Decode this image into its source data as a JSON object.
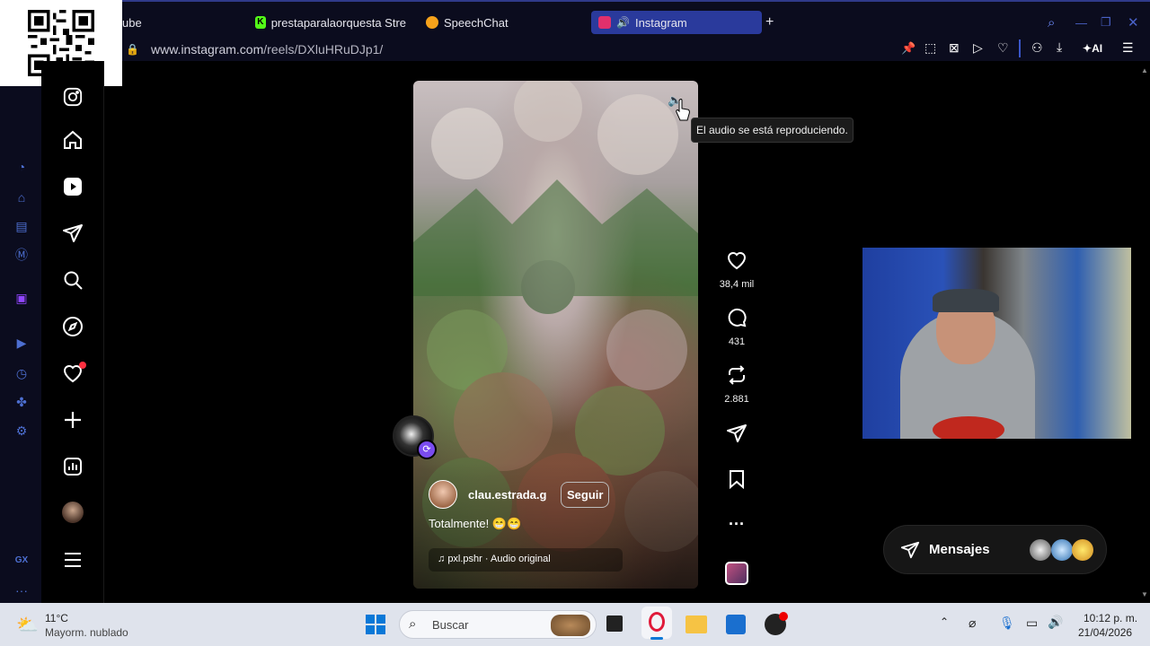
{
  "browser": {
    "tabs": [
      {
        "label": "ube",
        "color": "#ff0000"
      },
      {
        "label": "prestaparalaorquesta Stre",
        "color": "#53fc18"
      },
      {
        "label": "SpeechChat",
        "color": "#f7a21b"
      },
      {
        "label": "Instagram",
        "color": "#e1306c",
        "active": true
      }
    ],
    "new_tab": "+",
    "url_host": "www.instagram.com",
    "url_path": "/reels/DXluHRuDJp1/",
    "ai_label": "AI"
  },
  "reel": {
    "tooltip": "El audio se está reproduciendo.",
    "username": "clau.estrada.g",
    "follow_label": "Seguir",
    "caption": "Totalmente! 😁😁",
    "audio": "pxl.pshr · Audio original",
    "likes": "38,4 mil",
    "comments": "431",
    "reposts": "2.881"
  },
  "messages": {
    "label": "Mensajes"
  },
  "taskbar": {
    "temp": "11°C",
    "weather": "Mayorm. nublado",
    "search": "Buscar",
    "time": "10:12 p. m.",
    "date": "21/04/2026"
  },
  "rail": {
    "gx": "GX",
    "more": "···"
  }
}
